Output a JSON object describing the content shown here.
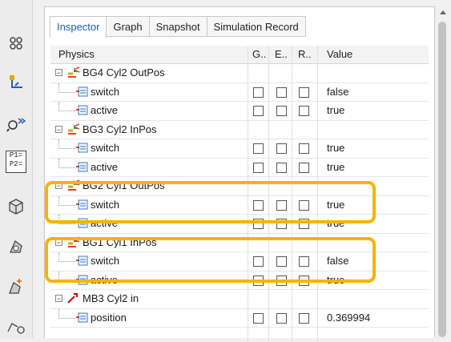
{
  "tabs": [
    "Inspector",
    "Graph",
    "Snapshot",
    "Simulation Record"
  ],
  "columns": {
    "physics": "Physics",
    "g": "G..",
    "e": "E..",
    "r": "R..",
    "value": "Value"
  },
  "rows": [
    {
      "name": "BG4 Cyl2 OutPos",
      "kind": "group",
      "value": ""
    },
    {
      "name": "switch",
      "kind": "leaf",
      "value": "false"
    },
    {
      "name": "active",
      "kind": "leaf",
      "value": "true"
    },
    {
      "name": "BG3 Cyl2 InPos",
      "kind": "group",
      "value": ""
    },
    {
      "name": "switch",
      "kind": "leaf",
      "value": "true"
    },
    {
      "name": "active",
      "kind": "leaf",
      "value": "true"
    },
    {
      "name": "BG2 Cyl1 OutPos",
      "kind": "group",
      "value": ""
    },
    {
      "name": "switch",
      "kind": "leaf",
      "value": "true"
    },
    {
      "name": "active",
      "kind": "leaf",
      "value": "true"
    },
    {
      "name": "BG1 Cyl1 InPos",
      "kind": "group",
      "value": ""
    },
    {
      "name": "switch",
      "kind": "leaf",
      "value": "false"
    },
    {
      "name": "active",
      "kind": "leaf",
      "value": "true"
    },
    {
      "name": "MB3 Cyl2 in",
      "kind": "motion",
      "value": ""
    },
    {
      "name": "position",
      "kind": "leaf",
      "value": "0.369994"
    }
  ],
  "toolbar_icons": [
    "grid-icon",
    "axis-icon",
    "zoom-icon",
    "p1-p2-icon",
    "cube-icon",
    "part-icon",
    "part-axis-icon",
    "part-select-icon"
  ],
  "toolbar_p_label": "P1=\nP2=",
  "colors": {
    "highlight": "#f5b400",
    "tab_active": "#1f5fb0"
  }
}
